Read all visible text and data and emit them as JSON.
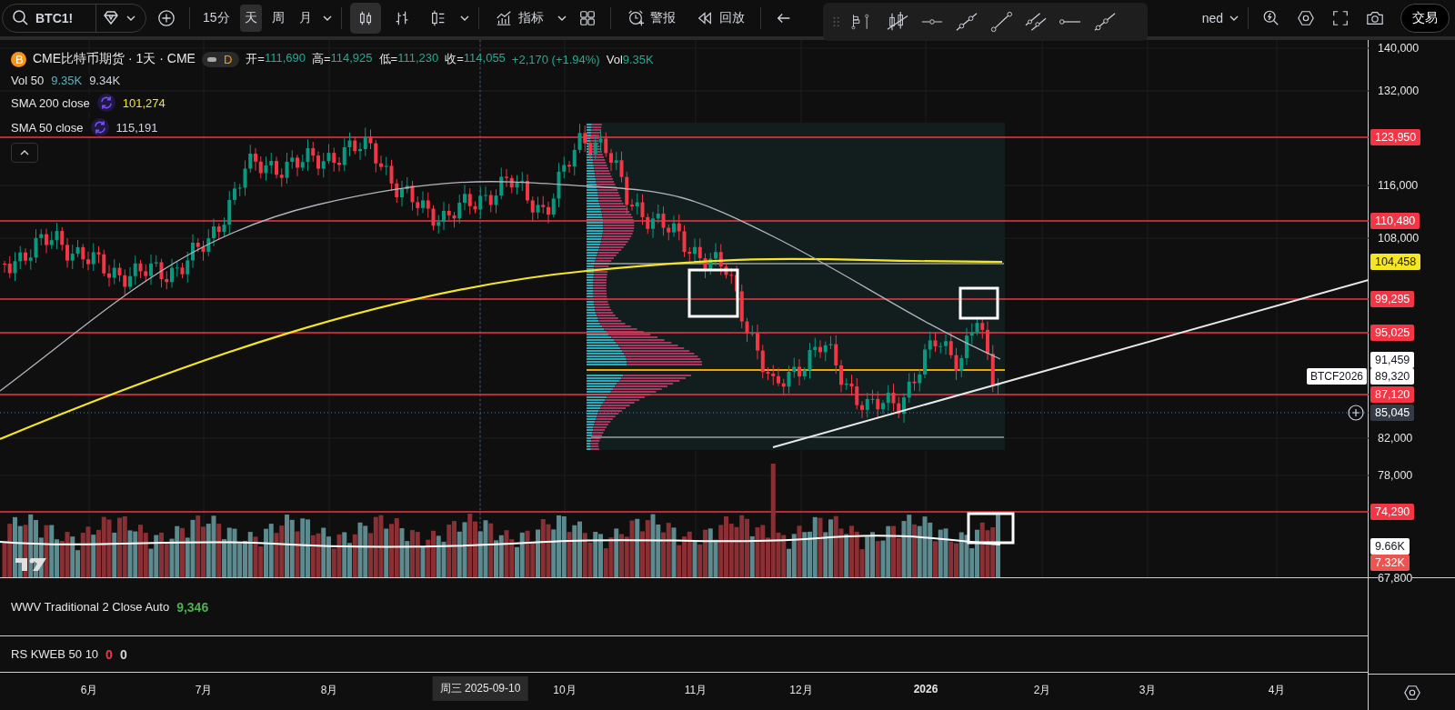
{
  "toolbar": {
    "symbol": "BTC1!",
    "intervals": [
      {
        "label": "15分",
        "selected": false
      },
      {
        "label": "天",
        "selected": true
      },
      {
        "label": "周",
        "selected": false
      },
      {
        "label": "月",
        "selected": false
      }
    ],
    "chart_types": [
      {
        "kind": "candles",
        "selected": true
      },
      {
        "kind": "bars",
        "selected": false
      },
      {
        "kind": "hollow",
        "selected": false
      }
    ],
    "indicators_label": "指标",
    "alerts_label": "警报",
    "replay_label": "回放",
    "layout_name": "ned",
    "trade_label": "交易"
  },
  "legend": {
    "title": "CME比特币期货 · 1天 · CME",
    "badge": "D",
    "ohlc": [
      {
        "label": "开=",
        "value": "111,690"
      },
      {
        "label": "高=",
        "value": "114,925"
      },
      {
        "label": "低=",
        "value": "111,230"
      },
      {
        "label": "收=",
        "value": "114,055"
      }
    ],
    "change": "+2,170 (+1.94%)",
    "volume_label": "Vol",
    "volume_value": "9.35K"
  },
  "indicators": [
    {
      "name": "Vol 50",
      "kind": "volume",
      "values": [
        {
          "text": "9.35K",
          "color": "#5fb0bd"
        },
        {
          "text": "9.34K",
          "color": "#d1d4dc"
        }
      ]
    },
    {
      "name": "SMA 200 close",
      "kind": "sma",
      "values": [
        {
          "text": "101,274",
          "color": "#f5e625"
        }
      ]
    },
    {
      "name": "SMA 50 close",
      "kind": "sma",
      "values": [
        {
          "text": "115,191",
          "color": "#d1d4dc"
        }
      ]
    }
  ],
  "price_axis": {
    "ticks": [
      {
        "label": "140,000"
      },
      {
        "label": "132,000"
      },
      {
        "label": "116,000"
      },
      {
        "label": "108,000"
      },
      {
        "label": "82,000"
      },
      {
        "label": "78,000"
      },
      {
        "label": "67,800"
      }
    ],
    "markers": [
      {
        "kind": "level",
        "text": "123,950",
        "color": "#f23645"
      },
      {
        "kind": "level",
        "text": "110,480",
        "color": "#f23645"
      },
      {
        "kind": "sma",
        "text": "104,458",
        "color": "#f5e625"
      },
      {
        "kind": "level",
        "text": "99,295",
        "color": "#f23645"
      },
      {
        "kind": "level",
        "text": "95,025",
        "color": "#f23645"
      },
      {
        "kind": "price",
        "text": "91,459",
        "color": "#ffffff"
      },
      {
        "kind": "price",
        "text": "89,320",
        "color": "#ffffff",
        "tag": "BTCF2026"
      },
      {
        "kind": "level",
        "text": "87,120",
        "color": "#f23645"
      },
      {
        "kind": "cursor",
        "text": "85,045",
        "color": "#363a45"
      },
      {
        "kind": "level",
        "text": "74,290",
        "color": "#f23645"
      },
      {
        "kind": "volume",
        "text": "9.66K",
        "color": "#ffffff"
      },
      {
        "kind": "volume",
        "text": "7.32K",
        "color": "#ef5350"
      }
    ]
  },
  "panes": [
    {
      "name": "WWV Traditional 2 Close Auto",
      "values": [
        {
          "text": "9,346",
          "color": "#4caf50"
        }
      ]
    },
    {
      "name": "RS KWEB 50 10",
      "values": [
        {
          "text": "0",
          "color": "#f23645"
        },
        {
          "text": "0",
          "color": "#d1d4dc"
        }
      ]
    }
  ],
  "time_axis": {
    "labels": [
      {
        "label": "6月",
        "kind": "month"
      },
      {
        "label": "7月",
        "kind": "month"
      },
      {
        "label": "8月",
        "kind": "month"
      },
      {
        "label": "周三 2025-09-10",
        "kind": "cursor"
      },
      {
        "label": "10月",
        "kind": "month"
      },
      {
        "label": "11月",
        "kind": "month"
      },
      {
        "label": "12月",
        "kind": "month"
      },
      {
        "label": "2026",
        "kind": "year"
      },
      {
        "label": "2月",
        "kind": "month"
      },
      {
        "label": "3月",
        "kind": "month"
      },
      {
        "label": "4月",
        "kind": "month"
      }
    ]
  }
}
